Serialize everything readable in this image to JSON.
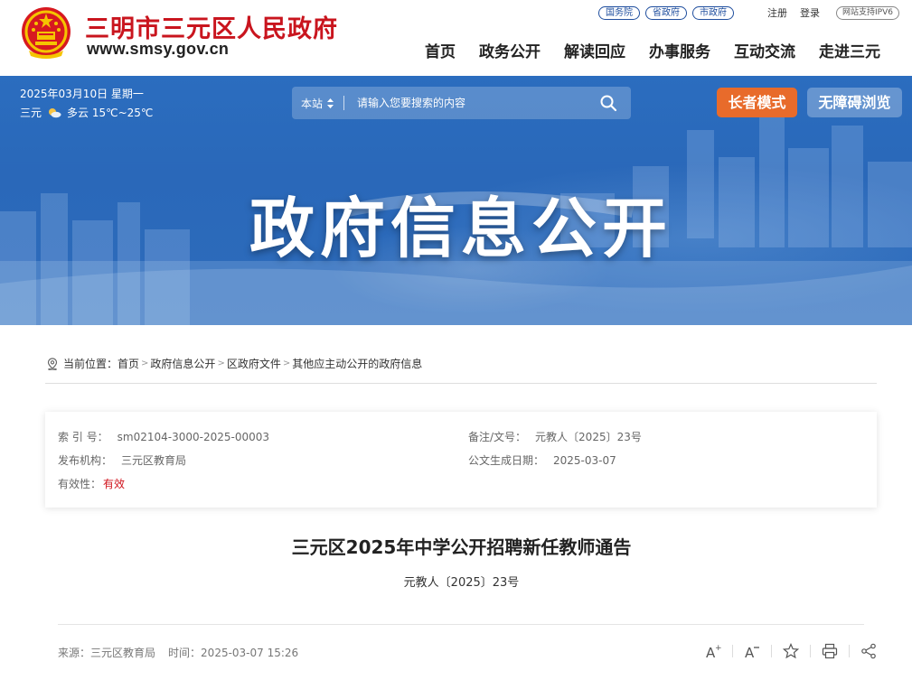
{
  "header": {
    "site_title": "三明市三元区人民政府",
    "site_domain": "www.smsy.gov.cn",
    "top_links": [
      "国务院",
      "省政府",
      "市政府"
    ],
    "auth_links": [
      "注册",
      "登录"
    ],
    "ipv6_badge": "网站支持IPV6",
    "nav": [
      "首页",
      "政务公开",
      "解读回应",
      "办事服务",
      "互动交流",
      "走进三元"
    ]
  },
  "banner": {
    "date": "2025年03月10日 星期一",
    "weather_city": "三元",
    "weather_icon": "partly-cloudy-icon",
    "weather_desc": "多云 15℃~25℃",
    "search_scope": "本站",
    "search_placeholder": "请输入您要搜索的内容",
    "elder_mode_label": "长者模式",
    "accessibility_label": "无障碍浏览",
    "title": "政府信息公开",
    "colors": {
      "banner_blue": "#2b6dbf",
      "elder_orange": "#e86b2b",
      "brand_red": "#c9151e"
    }
  },
  "breadcrumb": {
    "prefix": "当前位置：",
    "items": [
      "首页",
      "政府信息公开",
      "区政府文件",
      "其他应主动公开的政府信息"
    ],
    "separator": ">"
  },
  "meta": {
    "index_label": "索 引 号：",
    "index_value": "sm02104-3000-2025-00003",
    "doc_no_label": "备注/文号：",
    "doc_no_value": "元教人〔2025〕23号",
    "issuer_label": "发布机构：",
    "issuer_value": "三元区教育局",
    "created_label": "公文生成日期：",
    "created_value": "2025-03-07",
    "validity_label": "有效性：",
    "validity_value": "有效"
  },
  "article": {
    "title": "三元区2025年中学公开招聘新任教师通告",
    "doc_number": "元教人〔2025〕23号",
    "source_label": "来源：",
    "source_value": "三元区教育局",
    "time_label": "时间：",
    "time_value": "2025-03-07 15:26",
    "tools": [
      "font-increase-icon",
      "font-decrease-icon",
      "favorite-star-icon",
      "print-icon",
      "share-icon"
    ]
  }
}
